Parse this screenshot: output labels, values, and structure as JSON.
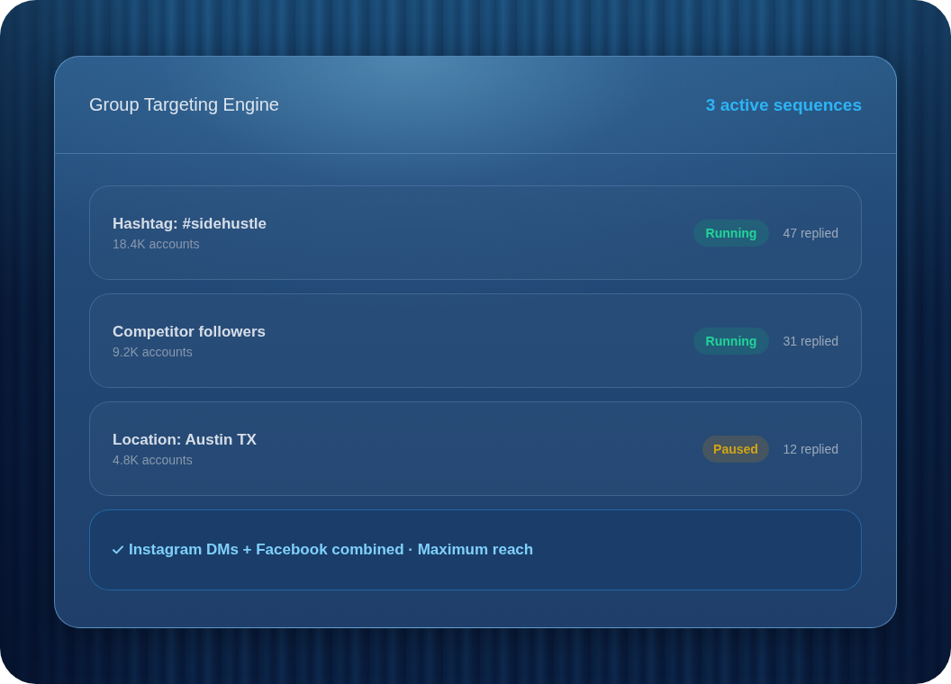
{
  "header": {
    "title": "Group Targeting Engine",
    "summary": "3 active sequences"
  },
  "sequences": [
    {
      "name": "Hashtag: #sidehustle",
      "audience": "18.4K accounts",
      "status": {
        "kind": "running",
        "label": "Running"
      },
      "replies": "47 replied"
    },
    {
      "name": "Competitor followers",
      "audience": "9.2K accounts",
      "status": {
        "kind": "running",
        "label": "Running"
      },
      "replies": "31 replied"
    },
    {
      "name": "Location: Austin TX",
      "audience": "4.8K accounts",
      "status": {
        "kind": "paused",
        "label": "Paused"
      },
      "replies": "12 replied"
    }
  ],
  "footer_note": {
    "text": "Instagram DMs + Facebook combined · Maximum reach"
  }
}
